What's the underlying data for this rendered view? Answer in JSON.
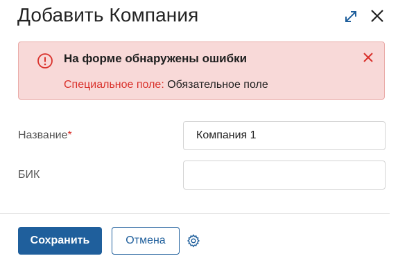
{
  "dialog": {
    "title": "Добавить Компания",
    "expand_icon": "expand-icon",
    "close_icon": "close-icon"
  },
  "alert": {
    "icon": "error-circle-icon",
    "title": "На форме обнаружены ошибки",
    "error_field": "Специальное поле:",
    "error_text": " Обязательное поле",
    "close_icon": "close-icon",
    "colors": {
      "background": "#f8d9d8",
      "border": "#e9a9a6",
      "accent": "#d9312b"
    }
  },
  "form": {
    "fields": [
      {
        "label": "Название",
        "required_mark": "*",
        "value": "Компания 1"
      },
      {
        "label": "БИК",
        "value": ""
      }
    ]
  },
  "footer": {
    "save_label": "Сохранить",
    "cancel_label": "Отмена",
    "settings_icon": "gear-icon",
    "primary_color": "#1f5f9c"
  }
}
